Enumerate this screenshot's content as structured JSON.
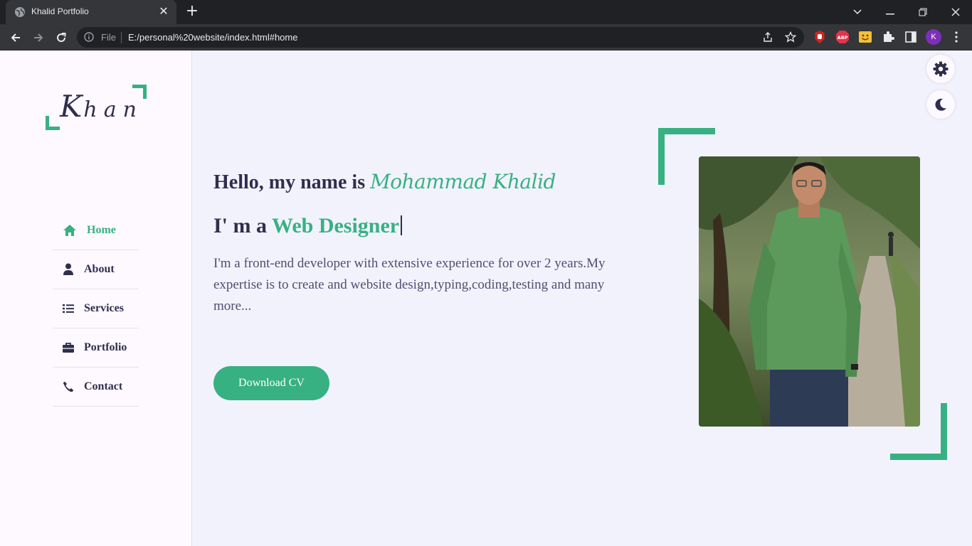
{
  "browser": {
    "tab_title": "Khalid Portfolio",
    "url_scheme": "File",
    "url": "E:/personal%20website/index.html#home",
    "profile_initial": "K",
    "extensions": [
      "hand-stop-icon",
      "adblock-icon",
      "smiley-icon",
      "puzzle-icon",
      "sidepanel-icon"
    ]
  },
  "sidebar": {
    "logo_initial": "K",
    "logo_rest": "han",
    "nav": [
      {
        "label": "Home",
        "icon": "home-icon",
        "active": true
      },
      {
        "label": "About",
        "icon": "user-icon",
        "active": false
      },
      {
        "label": "Services",
        "icon": "list-icon",
        "active": false
      },
      {
        "label": "Portfolio",
        "icon": "briefcase-icon",
        "active": false
      },
      {
        "label": "Contact",
        "icon": "phone-icon",
        "active": false
      }
    ]
  },
  "hero": {
    "greeting": "Hello, my name is ",
    "name": "Mohammad Khalid",
    "role_prefix": "I' m a ",
    "role": "Web Designer",
    "description": "I'm a front-end developer with extensive experience for over 2 years.My expertise is to create and website design,typing,coding,testing and many more...",
    "cta": "Download CV"
  },
  "colors": {
    "accent": "#37b182",
    "text_dark": "#302e4d",
    "background": "#f2f2fc",
    "sidebar_bg": "#fdf9ff"
  }
}
